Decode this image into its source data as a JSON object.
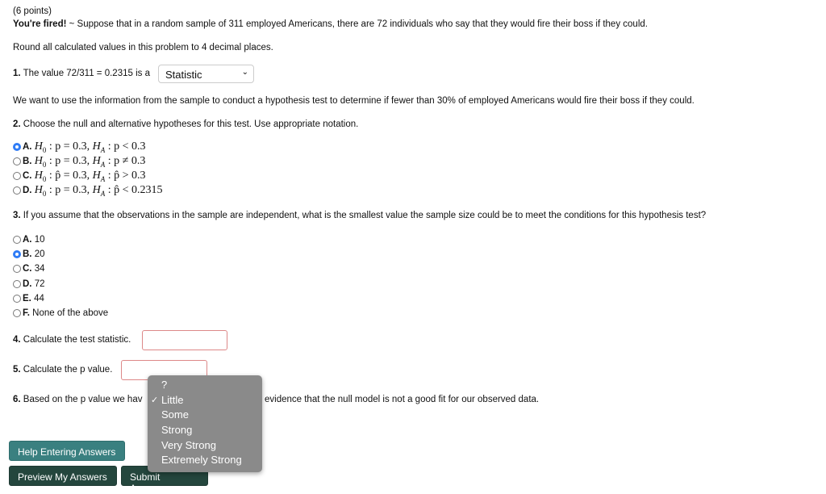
{
  "points": "(6 points)",
  "intro_title": "You're fired!",
  "intro_text": " ~ Suppose that in a random sample of 311 employed Americans, there are 72 individuals who say that they would fire their boss if they could.",
  "round_note": "Round all calculated values in this problem to 4 decimal places.",
  "q1": {
    "num": "1.",
    "text": " The value 72/311 = 0.2315 is a",
    "selected": "Statistic"
  },
  "context": "We want to use the information from the sample to conduct a hypothesis test to determine if fewer than 30% of employed Americans would fire their boss if they could.",
  "q2": {
    "num": "2.",
    "text": " Choose the null and alternative hypotheses for this test. Use appropriate notation.",
    "options": [
      {
        "label": "A.",
        "h0": "p = 0.3",
        "ha": "p < 0.3",
        "selected": true
      },
      {
        "label": "B.",
        "h0": "p = 0.3",
        "ha": "p ≠ 0.3",
        "selected": false
      },
      {
        "label": "C.",
        "h0": "p̂ = 0.3",
        "ha": "p̂ > 0.3",
        "selected": false
      },
      {
        "label": "D.",
        "h0": "p = 0.3",
        "ha": "p̂ < 0.2315",
        "selected": false
      }
    ]
  },
  "q3": {
    "num": "3.",
    "text": " If you assume that the observations in the sample are independent, what is the smallest value the sample size could be to meet the conditions for this hypothesis test?",
    "options": [
      {
        "label": "A.",
        "text": " 10",
        "selected": false
      },
      {
        "label": "B.",
        "text": " 20",
        "selected": true
      },
      {
        "label": "C.",
        "text": " 34",
        "selected": false
      },
      {
        "label": "D.",
        "text": " 72",
        "selected": false
      },
      {
        "label": "E.",
        "text": " 44",
        "selected": false
      },
      {
        "label": "F.",
        "text": " None of the above",
        "selected": false
      }
    ]
  },
  "q4": {
    "num": "4.",
    "text": " Calculate the test statistic.",
    "value": ""
  },
  "q5": {
    "num": "5.",
    "text": " Calculate the p value.",
    "value": ""
  },
  "q6": {
    "num": "6.",
    "text_before": " Based on the p value we hav",
    "text_after": "evidence that the null model is not a good fit for our observed data.",
    "menu": [
      "?",
      "Little",
      "Some",
      "Strong",
      "Very Strong",
      "Extremely Strong"
    ],
    "checked": "Little"
  },
  "buttons": {
    "help": "Help Entering Answers",
    "preview": "Preview My Answers",
    "submit": "Submit Answers"
  },
  "colors": {
    "help": "#3a8080",
    "dark": "#24463d",
    "radio": "#2f7cf6"
  }
}
